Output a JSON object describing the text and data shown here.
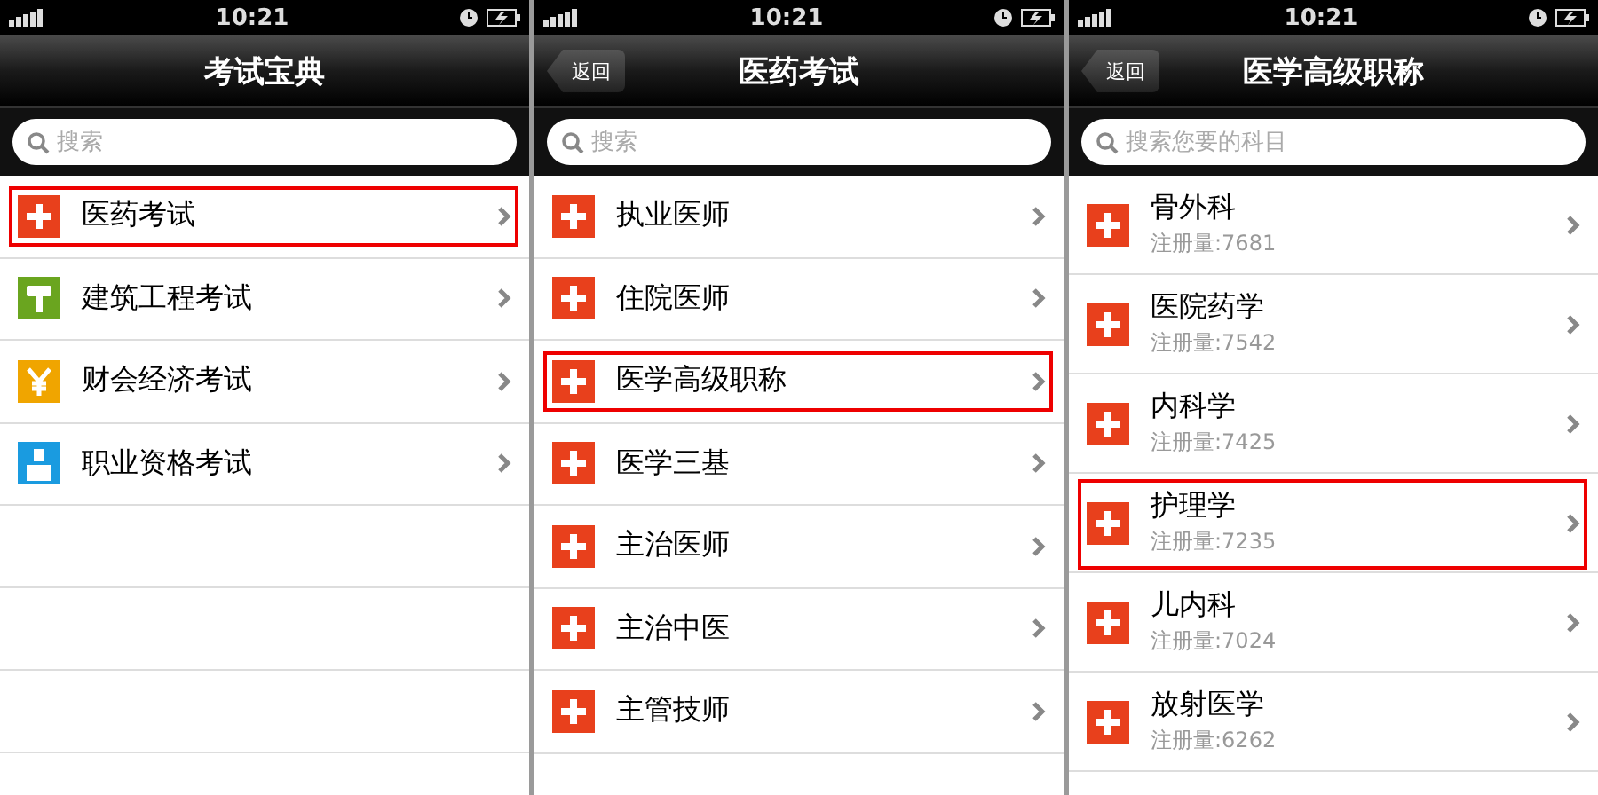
{
  "screens": [
    {
      "status_bar": {
        "time": "10:21"
      },
      "title": "考试宝典",
      "search": {
        "placeholder": "搜索"
      },
      "items": [
        {
          "label": "医药考试",
          "kind": "cross",
          "color": "#e8401c",
          "highlighted": true
        },
        {
          "label": "建筑工程考试",
          "kind": "stamp",
          "color": "#6aa51f",
          "highlighted": false
        },
        {
          "label": "财会经济考试",
          "kind": "yen",
          "color": "#f0a500",
          "highlighted": false
        },
        {
          "label": "职业资格考试",
          "kind": "person",
          "color": "#1a9be0",
          "highlighted": false
        }
      ]
    },
    {
      "status_bar": {
        "time": "10:21"
      },
      "title": "医药考试",
      "back_button": "返回",
      "search": {
        "placeholder": "搜索"
      },
      "items": [
        {
          "label": "执业医师",
          "kind": "cross",
          "color": "#e8401c",
          "highlighted": false
        },
        {
          "label": "住院医师",
          "kind": "cross",
          "color": "#e8401c",
          "highlighted": false
        },
        {
          "label": "医学高级职称",
          "kind": "cross",
          "color": "#e8401c",
          "highlighted": true
        },
        {
          "label": "医学三基",
          "kind": "cross",
          "color": "#e8401c",
          "highlighted": false
        },
        {
          "label": "主治医师",
          "kind": "cross",
          "color": "#e8401c",
          "highlighted": false
        },
        {
          "label": "主治中医",
          "kind": "cross",
          "color": "#e8401c",
          "highlighted": false
        },
        {
          "label": "主管技师",
          "kind": "cross",
          "color": "#e8401c",
          "highlighted": false
        }
      ]
    },
    {
      "status_bar": {
        "time": "10:21"
      },
      "title": "医学高级职称",
      "back_button": "返回",
      "search": {
        "placeholder": "搜索您要的科目"
      },
      "items": [
        {
          "label": "骨外科",
          "subtitle": "注册量:7681",
          "kind": "cross",
          "color": "#e8401c",
          "highlighted": false
        },
        {
          "label": "医院药学",
          "subtitle": "注册量:7542",
          "kind": "cross",
          "color": "#e8401c",
          "highlighted": false
        },
        {
          "label": "内科学",
          "subtitle": "注册量:7425",
          "kind": "cross",
          "color": "#e8401c",
          "highlighted": false
        },
        {
          "label": "护理学",
          "subtitle": "注册量:7235",
          "kind": "cross",
          "color": "#e8401c",
          "highlighted": true
        },
        {
          "label": "儿内科",
          "subtitle": "注册量:7024",
          "kind": "cross",
          "color": "#e8401c",
          "highlighted": false
        },
        {
          "label": "放射医学",
          "subtitle": "注册量:6262",
          "kind": "cross",
          "color": "#e8401c",
          "highlighted": false
        }
      ]
    }
  ]
}
